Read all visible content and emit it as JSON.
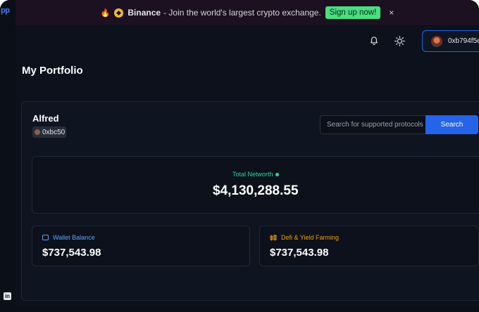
{
  "rail": {
    "logo": "pp",
    "linkedin": "in"
  },
  "banner": {
    "fire": "🔥",
    "brand": "Binance",
    "message": "- Join the world's largest crypto exchange.",
    "cta": "Sign up now!",
    "close": "×"
  },
  "header": {
    "wallet_address": "0xb794f5e"
  },
  "page": {
    "title": "My Portfolio"
  },
  "profile": {
    "name": "Alfred",
    "address": "0xbc50"
  },
  "search": {
    "placeholder": "Search for supported protocols",
    "button": "Search"
  },
  "networth": {
    "label": "Total Networth",
    "value": "$4,130,288.55"
  },
  "cards": {
    "wallet": {
      "label": "Wallet Balance",
      "value": "$737,543.98"
    },
    "defi": {
      "label": "Defi & Yield Farming",
      "value": "$737,543.98"
    }
  },
  "colors": {
    "accent": "#2563eb",
    "success": "#34d399",
    "wallet": "#60a5fa",
    "defi": "#f59e0b",
    "cta": "#4ade80"
  },
  "icons": [
    "fire-icon",
    "binance-icon",
    "close-icon",
    "bell-icon",
    "sun-icon",
    "avatar",
    "info-icon",
    "wallet-icon",
    "defi-icon",
    "linkedin-icon"
  ]
}
